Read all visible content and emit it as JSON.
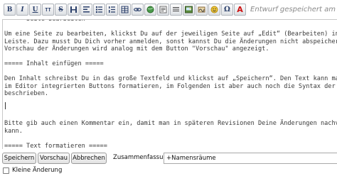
{
  "toolbar": {
    "buttons": [
      {
        "name": "bold-button",
        "icon": "bold-icon",
        "glyph": "B"
      },
      {
        "name": "italic-button",
        "icon": "italic-icon",
        "glyph": "I"
      },
      {
        "name": "underline-button",
        "icon": "underline-icon",
        "glyph": "U"
      },
      {
        "name": "teletype-button",
        "icon": "teletype-icon",
        "glyph": "TT"
      },
      {
        "name": "strikethrough-button",
        "icon": "strikethrough-icon",
        "glyph": "S"
      },
      {
        "name": "heading-button",
        "icon": "heading-icon",
        "glyph": ""
      },
      {
        "name": "align-button",
        "icon": "align-icon",
        "glyph": ""
      },
      {
        "name": "bullet-list-button",
        "icon": "bullet-list-icon",
        "glyph": ""
      },
      {
        "name": "numbered-list-button",
        "icon": "numbered-list-icon",
        "glyph": ""
      },
      {
        "name": "table-button",
        "icon": "table-icon",
        "glyph": ""
      },
      {
        "name": "link-button",
        "icon": "link-icon",
        "glyph": ""
      },
      {
        "name": "external-link-button",
        "icon": "globe-icon",
        "glyph": ""
      },
      {
        "name": "textblock-button",
        "icon": "textblock-icon",
        "glyph": ""
      },
      {
        "name": "lines-button",
        "icon": "lines-icon",
        "glyph": ""
      },
      {
        "name": "image-button",
        "icon": "image-icon",
        "glyph": ""
      },
      {
        "name": "signature-button",
        "icon": "signature-icon",
        "glyph": ""
      },
      {
        "name": "smiley-button",
        "icon": "smiley-icon",
        "glyph": ""
      },
      {
        "name": "special-char-button",
        "icon": "omega-icon",
        "glyph": "Ω"
      },
      {
        "name": "color-button",
        "icon": "font-color-icon",
        "glyph": "A"
      }
    ],
    "draft_status": "Entwurf gespeichert am"
  },
  "editor": {
    "lines": [
      "===== Seite bearbeiten =====",
      "",
      "Um eine Seite zu bearbeiten, klickst Du auf der jeweiligen Seite auf „Edit“ (Bearbeiten) in",
      "Leiste. Dazu musst Du Dich vorher anmelden, sonst kannst Du die Änderungen nicht abspeichern",
      "Vorschau der Änderungen wird analog mit dem Button \"Vorschau\" angezeigt.",
      "",
      "===== Inhalt einfügen =====",
      "",
      "Den Inhalt schreibst Du in das große Textfeld und klickst auf „Speichern“. Den Text kann man",
      "im Editor integrierten Buttons formatieren, im Folgenden ist aber auch noch die Syntax der Fo",
      "beschrieben.",
      "",
      "",
      "",
      "Bitte gib auch einen Kommentar ein, damit man in späteren Revisionen Deine Änderungen nachvo",
      "kann.",
      "",
      "===== Text formatieren ====="
    ]
  },
  "actions": {
    "save_label": "Speichern",
    "preview_label": "Vorschau",
    "cancel_label": "Abbrechen",
    "summary_label": "Zusammenfassung",
    "summary_value": "+Namensräume"
  },
  "minor_edit": {
    "label": "Kleine Änderung",
    "checked": false
  },
  "colors": {
    "toolbar_icon": "#2a3f6a",
    "font_color_icon": "#cc1111",
    "draft_text": "#8a8a8a"
  }
}
